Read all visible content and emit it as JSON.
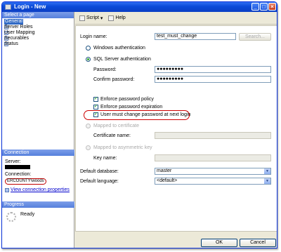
{
  "window": {
    "title": "Login - New"
  },
  "left_pane": {
    "select_page_header": "Select a page",
    "pages": [
      {
        "label": "General",
        "selected": true
      },
      {
        "label": "Server Roles",
        "selected": false
      },
      {
        "label": "User Mapping",
        "selected": false
      },
      {
        "label": "Securables",
        "selected": false
      },
      {
        "label": "Status",
        "selected": false
      }
    ],
    "connection_header": "Connection",
    "server_label": "Server:",
    "connection_label": "Connection:",
    "connection_value": "ERCOUNTY\\woods",
    "view_connection_properties": "View connection properties",
    "progress_header": "Progress",
    "progress_status": "Ready"
  },
  "toolbar": {
    "script_label": "Script",
    "help_label": "Help"
  },
  "form": {
    "login_name_label": "Login name:",
    "login_name_value": "test_must_change",
    "search_button": "Search...",
    "windows_auth_label": "Windows authentication",
    "sql_auth_label": "SQL Server authentication",
    "password_label": "Password:",
    "password_value": "●●●●●●●●●",
    "confirm_password_label": "Confirm password:",
    "confirm_password_value": "●●●●●●●●●",
    "enforce_policy_label": "Enforce password policy",
    "enforce_expiration_label": "Enforce password expiration",
    "must_change_label": "User must change password at next login",
    "mapped_certificate_label": "Mapped to certificate",
    "certificate_name_label": "Certificate name:",
    "mapped_asym_key_label": "Mapped to asymmetric key",
    "key_name_label": "Key name:",
    "default_database_label": "Default database:",
    "default_database_value": "master",
    "default_language_label": "Default language:",
    "default_language_value": "<default>"
  },
  "buttons": {
    "ok": "OK",
    "cancel": "Cancel"
  },
  "colors": {
    "accent": "#316ac5",
    "highlight_oval": "#cc0000",
    "title_bar": "#0a4ad8"
  }
}
